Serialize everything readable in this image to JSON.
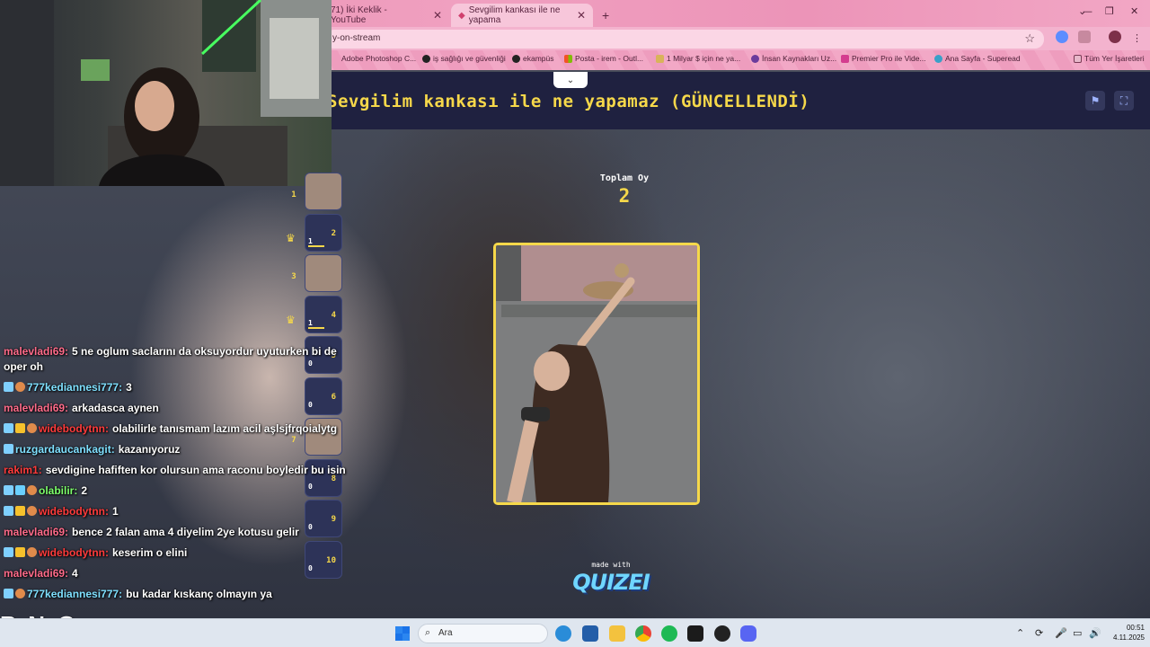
{
  "browser": {
    "tabs": [
      {
        "label": "71) İki Keklik - YouTube"
      },
      {
        "label": "Sevgilim kankası ile ne yapama"
      }
    ],
    "url": "y-on-stream",
    "bookmarks": [
      {
        "label": "Adobe Photoshop C..."
      },
      {
        "label": "iş sağlığı ve güvenliği"
      },
      {
        "label": "ekampüs"
      },
      {
        "label": "Posta - irem - Outl..."
      },
      {
        "label": "1 Milyar $ için ne ya..."
      },
      {
        "label": "İnsan Kaynakları Uz..."
      },
      {
        "label": "Premier Pro ile Vide..."
      },
      {
        "label": "Ana Sayfa - Superead"
      },
      {
        "label": "Tüm Yer İşaretleri"
      }
    ]
  },
  "quiz": {
    "title": "Sevgilim kankası ile ne yapamaz (GÜNCELLENDİ)",
    "total_votes_label": "Toplam Oy",
    "total_votes": "2",
    "made_with": "made with",
    "brand": "QUIZEI"
  },
  "leaderboard": [
    {
      "rank": "1",
      "num": "",
      "votes": "",
      "thumb": true
    },
    {
      "rank": "",
      "num": "2",
      "votes": "1",
      "thumb": false,
      "crown": true,
      "bar": true
    },
    {
      "rank": "3",
      "num": "",
      "votes": "",
      "thumb": true
    },
    {
      "rank": "",
      "num": "4",
      "votes": "1",
      "thumb": false,
      "crown": true,
      "bar": true
    },
    {
      "rank": "",
      "num": "5",
      "votes": "0",
      "thumb": false
    },
    {
      "rank": "",
      "num": "6",
      "votes": "0",
      "thumb": false
    },
    {
      "rank": "7",
      "num": "",
      "votes": "",
      "thumb": true
    },
    {
      "rank": "",
      "num": "8",
      "votes": "0",
      "thumb": false
    },
    {
      "rank": "",
      "num": "9",
      "votes": "0",
      "thumb": false
    },
    {
      "rank": "",
      "num": "10",
      "votes": "0",
      "thumb": false
    }
  ],
  "chat": [
    {
      "user": "malevladi69:",
      "color": "#ff6b8a",
      "text": "5 ne oglum saclarını da oksuyordur uyuturken bi de",
      "badges": []
    },
    {
      "user": "",
      "color": "#ffffff",
      "text": "oper oh",
      "badges": []
    },
    {
      "user": "777kediannesi777:",
      "color": "#7fe0ff",
      "text": "3",
      "badges": [
        "sword",
        "cookie"
      ]
    },
    {
      "user": "malevladi69:",
      "color": "#ff6b8a",
      "text": "arkadasca aynen",
      "badges": []
    },
    {
      "user": "widebodytnn:",
      "color": "#ff3b3b",
      "text": "olabilirle tanısmam lazım acil aşlsjfrqoialytg",
      "badges": [
        "sword",
        "crown",
        "cookie"
      ]
    },
    {
      "user": "ruzgardaucankagit:",
      "color": "#7fe0ff",
      "text": "kazanıyoruz",
      "badges": [
        "sword"
      ]
    },
    {
      "user": "rakim1:",
      "color": "#ff3b3b",
      "text": "sevdigine hafiften kor olursun ama raconu boyledir bu isin",
      "badges": []
    },
    {
      "user": "olabilir:",
      "color": "#7dff6b",
      "text": "2",
      "badges": [
        "sword",
        "grid",
        "cookie"
      ]
    },
    {
      "user": "widebodytnn:",
      "color": "#ff3b3b",
      "text": "1",
      "badges": [
        "sword",
        "crown",
        "cookie"
      ]
    },
    {
      "user": "malevladi69:",
      "color": "#ff6b8a",
      "text": "bence 2 falan ama 4 diyelim 2ye kotusu gelir",
      "badges": []
    },
    {
      "user": "widebodytnn:",
      "color": "#ff3b3b",
      "text": "keserim o elini",
      "badges": [
        "sword",
        "crown",
        "cookie"
      ]
    },
    {
      "user": "malevladi69:",
      "color": "#ff6b8a",
      "text": "4",
      "badges": []
    },
    {
      "user": "777kediannesi777:",
      "color": "#7fe0ff",
      "text": "bu kadar kıskanç olmayın ya",
      "badges": [
        "sword",
        "cookie"
      ]
    }
  ],
  "overlay_logo": "ByNoGame",
  "taskbar": {
    "search_placeholder": "Ara",
    "time": "00:51",
    "date": "4.11.2025"
  },
  "colors": {
    "accent": "#f6d84a",
    "header": "#1f2140",
    "card_border": "#f6d84a"
  }
}
